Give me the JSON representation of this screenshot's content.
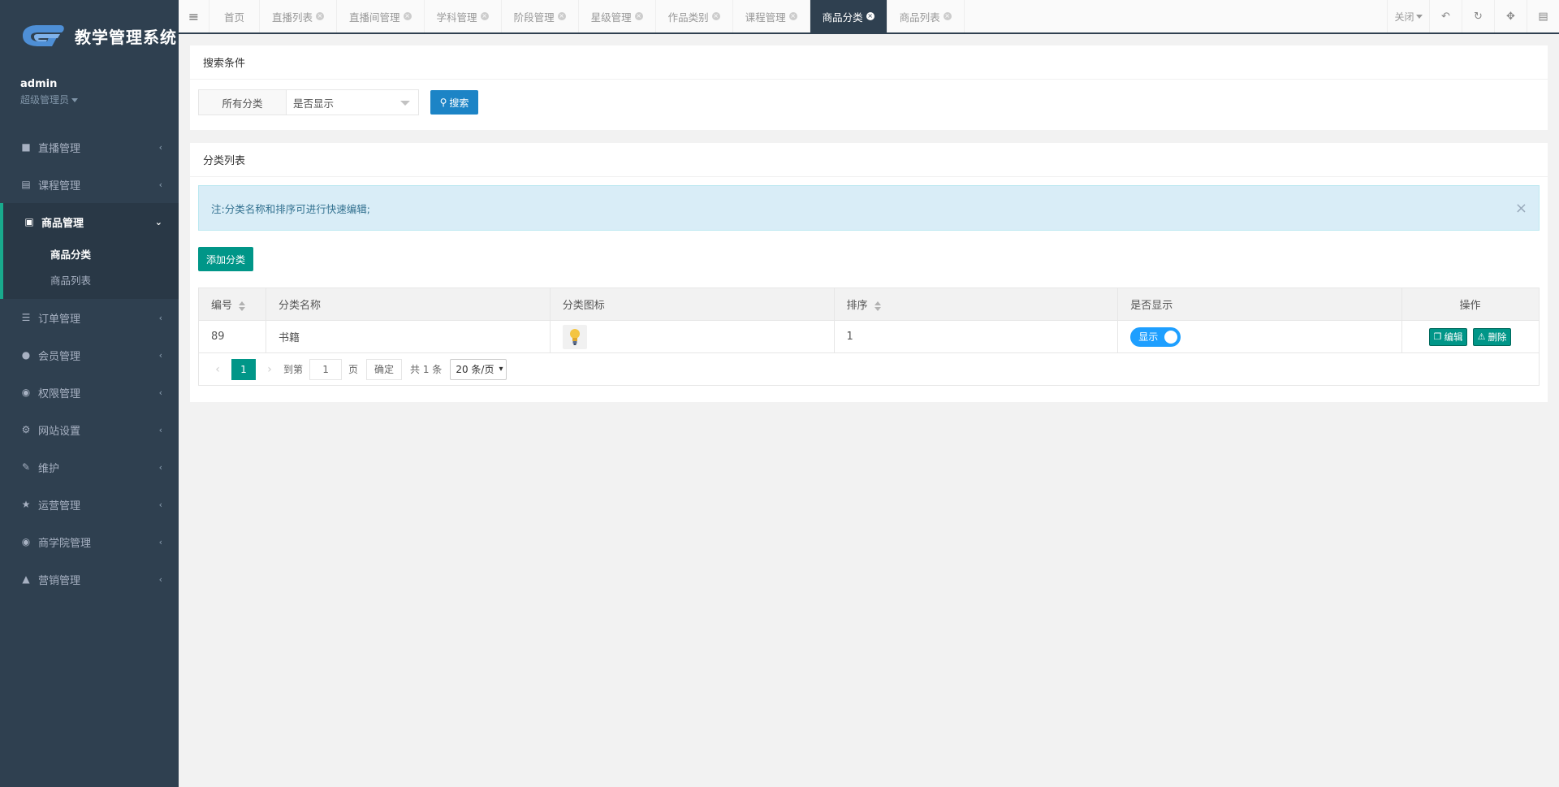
{
  "sidebar": {
    "logo_text": "教学管理系统",
    "user": {
      "name": "admin",
      "role": "超级管理员"
    },
    "items": [
      {
        "icon": "video-camera-icon",
        "label": "直播管理"
      },
      {
        "icon": "book-icon",
        "label": "课程管理"
      },
      {
        "icon": "cart-icon",
        "label": "商品管理",
        "active": true,
        "children": [
          "商品分类",
          "商品列表"
        ]
      },
      {
        "icon": "list-icon",
        "label": "订单管理"
      },
      {
        "icon": "user-icon",
        "label": "会员管理"
      },
      {
        "icon": "users-icon",
        "label": "权限管理"
      },
      {
        "icon": "gear-icon",
        "label": "网站设置"
      },
      {
        "icon": "wrench-icon",
        "label": "维护"
      },
      {
        "icon": "trophy-icon",
        "label": "运营管理"
      },
      {
        "icon": "users-icon",
        "label": "商学院管理"
      },
      {
        "icon": "bullhorn-icon",
        "label": "营销管理"
      }
    ]
  },
  "topbar": {
    "tabs": [
      "首页",
      "直播列表",
      "直播间管理",
      "学科管理",
      "阶段管理",
      "星级管理",
      "作品类别",
      "课程管理",
      "商品分类",
      "商品列表"
    ],
    "active_tab": "商品分类",
    "close_label": "关闭"
  },
  "search": {
    "title": "搜索条件",
    "category_label": "所有分类",
    "display_select": "是否显示",
    "search_button": "搜索"
  },
  "list": {
    "title": "分类列表",
    "notice": "注:分类名称和排序可进行快速编辑;",
    "add_button": "添加分类",
    "columns": [
      "编号",
      "分类名称",
      "分类图标",
      "排序",
      "是否显示",
      "操作"
    ],
    "rows": [
      {
        "id": "89",
        "name": "书籍",
        "icon": "lightbulb-thumbnail",
        "sort": "1",
        "display": "显示",
        "display_on": true,
        "edit": "编辑",
        "delete": "删除"
      }
    ]
  },
  "pager": {
    "current": "1",
    "goto_label": "到第",
    "page_input": "1",
    "page_unit": "页",
    "ok": "确定",
    "total": "共 1 条",
    "page_size": "20 条/页"
  },
  "colors": {
    "sidebar_bg": "#2f4050",
    "accent": "#009688",
    "primary": "#1c84c6",
    "toggle_on": "#1e9fff"
  }
}
